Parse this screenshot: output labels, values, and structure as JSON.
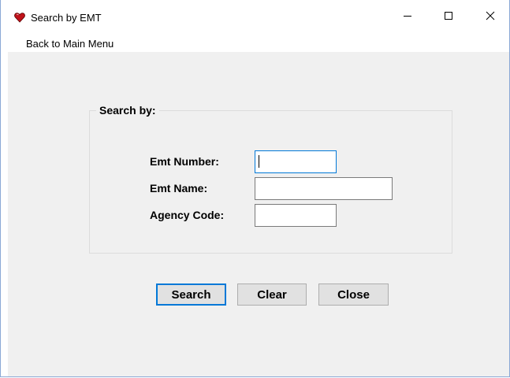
{
  "window": {
    "title": "Search by EMT",
    "icon": "heart-icon",
    "controls": {
      "minimize": "minimize-icon",
      "maximize": "maximize-icon",
      "close": "close-icon"
    }
  },
  "menu": {
    "items": [
      {
        "label": "Back to Main Menu"
      }
    ]
  },
  "form": {
    "group_label": "Search by:",
    "fields": {
      "emt_number": {
        "label": "Emt Number:",
        "value": ""
      },
      "emt_name": {
        "label": "Emt Name:",
        "value": ""
      },
      "agency_code": {
        "label": "Agency Code:",
        "value": ""
      }
    }
  },
  "buttons": {
    "search": "Search",
    "clear": "Clear",
    "close": "Close"
  },
  "colors": {
    "accent": "#0078d7",
    "client_bg": "#f0f0f0",
    "icon_red": "#c0121a"
  }
}
